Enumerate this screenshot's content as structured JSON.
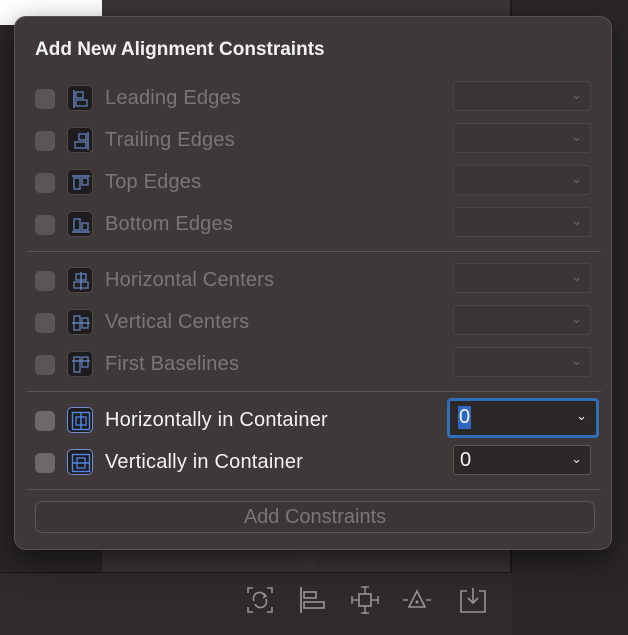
{
  "popover": {
    "title": "Add New Alignment Constraints",
    "group1": [
      {
        "label": "Leading Edges",
        "value": "",
        "enabled": false,
        "icon": "leading-edges-icon"
      },
      {
        "label": "Trailing Edges",
        "value": "",
        "enabled": false,
        "icon": "trailing-edges-icon"
      },
      {
        "label": "Top Edges",
        "value": "",
        "enabled": false,
        "icon": "top-edges-icon"
      },
      {
        "label": "Bottom Edges",
        "value": "",
        "enabled": false,
        "icon": "bottom-edges-icon"
      }
    ],
    "group2": [
      {
        "label": "Horizontal Centers",
        "value": "",
        "enabled": false,
        "icon": "horizontal-centers-icon"
      },
      {
        "label": "Vertical Centers",
        "value": "",
        "enabled": false,
        "icon": "vertical-centers-icon"
      },
      {
        "label": "First Baselines",
        "value": "",
        "enabled": false,
        "icon": "first-baselines-icon"
      }
    ],
    "group3": [
      {
        "label": "Horizontally in Container",
        "value": "0",
        "enabled": true,
        "icon": "horizontally-in-container-icon"
      },
      {
        "label": "Vertically in Container",
        "value": "0",
        "enabled": true,
        "icon": "vertically-in-container-icon"
      }
    ],
    "add_button_label": "Add Constraints"
  },
  "toolbar": {
    "icons": [
      "update-frames-icon",
      "align-icon",
      "add-constraints-icon",
      "resolve-issues-icon",
      "embed-in-icon"
    ]
  },
  "colors": {
    "accent": "#2f6fb8",
    "popover_bg": "#3e3838",
    "label_enabled": "#f3f3f3",
    "label_disabled": "#7c7576"
  }
}
